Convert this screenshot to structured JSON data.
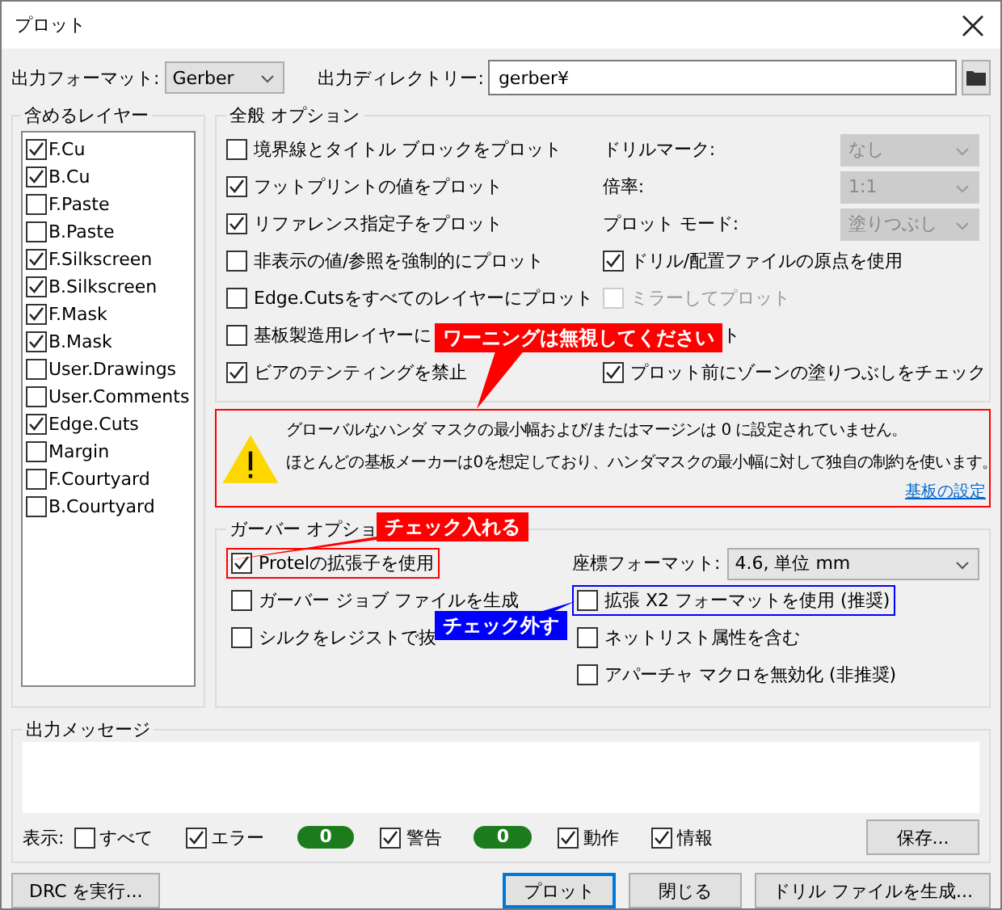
{
  "window": {
    "title": "プロット"
  },
  "output_format": {
    "label": "出力フォーマット:",
    "value": "Gerber"
  },
  "output_directory": {
    "label": "出力ディレクトリー:",
    "value": "gerber¥"
  },
  "layers": {
    "title": "含めるレイヤー",
    "items": [
      {
        "name": "F.Cu",
        "checked": true
      },
      {
        "name": "B.Cu",
        "checked": true
      },
      {
        "name": "F.Paste",
        "checked": false
      },
      {
        "name": "B.Paste",
        "checked": false
      },
      {
        "name": "F.Silkscreen",
        "checked": true
      },
      {
        "name": "B.Silkscreen",
        "checked": true
      },
      {
        "name": "F.Mask",
        "checked": true
      },
      {
        "name": "B.Mask",
        "checked": true
      },
      {
        "name": "User.Drawings",
        "checked": false
      },
      {
        "name": "User.Comments",
        "checked": false
      },
      {
        "name": "Edge.Cuts",
        "checked": true
      },
      {
        "name": "Margin",
        "checked": false
      },
      {
        "name": "F.Courtyard",
        "checked": false
      },
      {
        "name": "B.Courtyard",
        "checked": false
      }
    ]
  },
  "general_options": {
    "title": "全般 オプション",
    "left": [
      {
        "label": "境界線とタイトル ブロックをプロット",
        "checked": false
      },
      {
        "label": "フットプリントの値をプロット",
        "checked": true
      },
      {
        "label": "リファレンス指定子をプロット",
        "checked": true
      },
      {
        "label": "非表示の値/参照を強制的にプロット",
        "checked": false
      },
      {
        "label": "Edge.Cutsをすべてのレイヤーにプロット",
        "checked": false
      },
      {
        "label": "基板製造用レイヤーに",
        "checked": false
      },
      {
        "label": "ビアのテンティングを禁止",
        "checked": true
      }
    ],
    "right": [
      {
        "kind": "select",
        "label": "ドリルマーク:",
        "value": "なし",
        "disabled": true
      },
      {
        "kind": "select",
        "label": "倍率:",
        "value": "1:1",
        "disabled": true
      },
      {
        "kind": "select",
        "label": "プロット モード:",
        "value": "塗りつぶし",
        "disabled": true
      },
      {
        "kind": "checkbox",
        "label": "ドリル/配置ファイルの原点を使用",
        "checked": true,
        "disabled": false
      },
      {
        "kind": "checkbox",
        "label": "ミラーしてプロット",
        "checked": false,
        "disabled": true
      },
      {
        "kind": "text",
        "label": "ト"
      },
      {
        "kind": "checkbox",
        "label": "プロット前にゾーンの塗りつぶしをチェック",
        "checked": true,
        "disabled": false
      }
    ]
  },
  "warning": {
    "color": "#ff0000",
    "lines": [
      "グローバルなハンダ マスクの最小幅および/またはマージンは 0 に設定されていません。",
      "ほとんどの基板メーカーは0を想定しており、ハンダマスクの最小幅に対して独自の制約を使います。"
    ],
    "link": "基板の設定"
  },
  "gerber_options": {
    "title": "ガーバー オプショ",
    "left": [
      {
        "label": "Protelの拡張子を使用",
        "checked": true,
        "color": "#ff0000"
      },
      {
        "label": "ガーバー ジョブ ファイルを生成",
        "checked": false
      },
      {
        "label": "シルクをレジストで抜",
        "checked": false
      }
    ],
    "coordinate_format": {
      "label": "座標フォーマット:",
      "value": "4.6, 単位 mm"
    },
    "right": [
      {
        "label": "拡張 X2 フォーマットを使用 (推奨)",
        "checked": false,
        "color": "#0000ff"
      },
      {
        "label": "ネットリスト属性を含む",
        "checked": false
      },
      {
        "label": "アパーチャ マクロを無効化 (非推奨)",
        "checked": false
      }
    ]
  },
  "messages": {
    "title": "出力メッセージ",
    "show_label": "表示:",
    "filters": [
      {
        "label": "すべて",
        "checked": false
      },
      {
        "label": "エラー",
        "checked": true,
        "count": "0"
      },
      {
        "label": "警告",
        "checked": true,
        "count": "0"
      },
      {
        "label": "動作",
        "checked": true
      },
      {
        "label": "情報",
        "checked": true
      }
    ],
    "save": "保存..."
  },
  "buttons": {
    "left": "DRC を実行...",
    "right": [
      {
        "label": "プロット",
        "default": true
      },
      {
        "label": "閉じる",
        "default": false
      },
      {
        "label": "ドリル ファイルを生成...",
        "default": false
      }
    ]
  },
  "annotations": [
    {
      "text": "ワーニングは無視してください",
      "color": "#ff0000"
    },
    {
      "text": "チェック入れる",
      "color": "#ff0000"
    },
    {
      "text": "チェック外す",
      "color": "#0000ff"
    }
  ]
}
